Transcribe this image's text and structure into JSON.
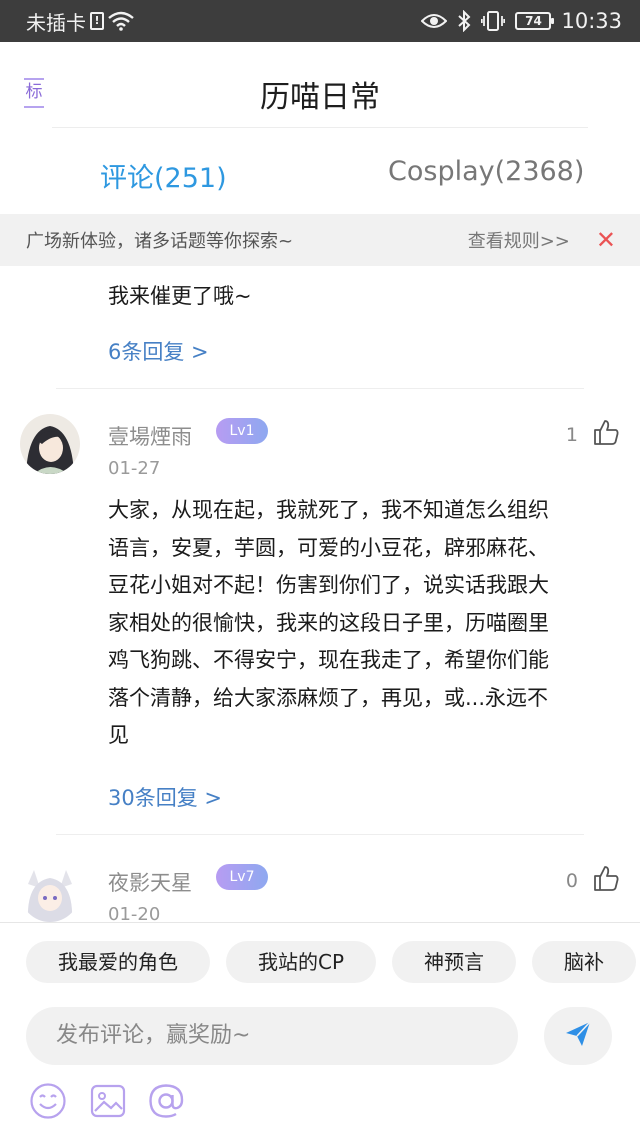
{
  "status_bar": {
    "carrier": "未插卡",
    "sim_badge": "!",
    "battery": "74",
    "time": "10:33"
  },
  "header": {
    "tag_label": "标",
    "title": "历喵日常"
  },
  "tabs": [
    {
      "label": "评论(251)",
      "active": true
    },
    {
      "label": "Cosplay(2368)",
      "active": false
    }
  ],
  "banner": {
    "text": "广场新体验，诸多话题等你探索~",
    "rules_link": "查看规则>>",
    "close": "✕"
  },
  "comments": [
    {
      "text": "我来催更了哦~",
      "replies": "6条回复 >"
    },
    {
      "username": "壹場煙雨",
      "level": "Lv1",
      "date": "01-27",
      "likes": "1",
      "text_lines": [
        "大家，从现在起，我就死了，我不知道怎么组织",
        "语言，安夏，芋圆，可爱的小豆花，辟邪麻花、",
        "豆花小姐对不起！伤害到你们了，说实话我跟大",
        "家相处的很愉快，我来的这段日子里，历喵圈里",
        "鸡飞狗跳、不得安宁，现在我走了，希望你们能",
        "落个清静，给大家添麻烦了，再见，或...永远不",
        "见"
      ],
      "replies": "30条回复 >"
    },
    {
      "username": "夜影天星",
      "level": "Lv7",
      "date": "01-20",
      "likes": "0"
    }
  ],
  "composer": {
    "chips": [
      "我最爱的角色",
      "我站的CP",
      "神预言",
      "脑补"
    ],
    "placeholder": "发布评论，赢奖励~"
  },
  "colors": {
    "accent_blue": "#2e98e0",
    "link_blue": "#4680c5",
    "level_gradient": "#b79cf2",
    "close_red": "#ea5354",
    "tool_purple": "#b7a2ee"
  },
  "icons": [
    "wifi-icon",
    "eye-icon",
    "bluetooth-icon",
    "vibrate-icon",
    "thumbs-up-icon",
    "send-icon",
    "emoji-icon",
    "image-icon",
    "at-icon"
  ]
}
